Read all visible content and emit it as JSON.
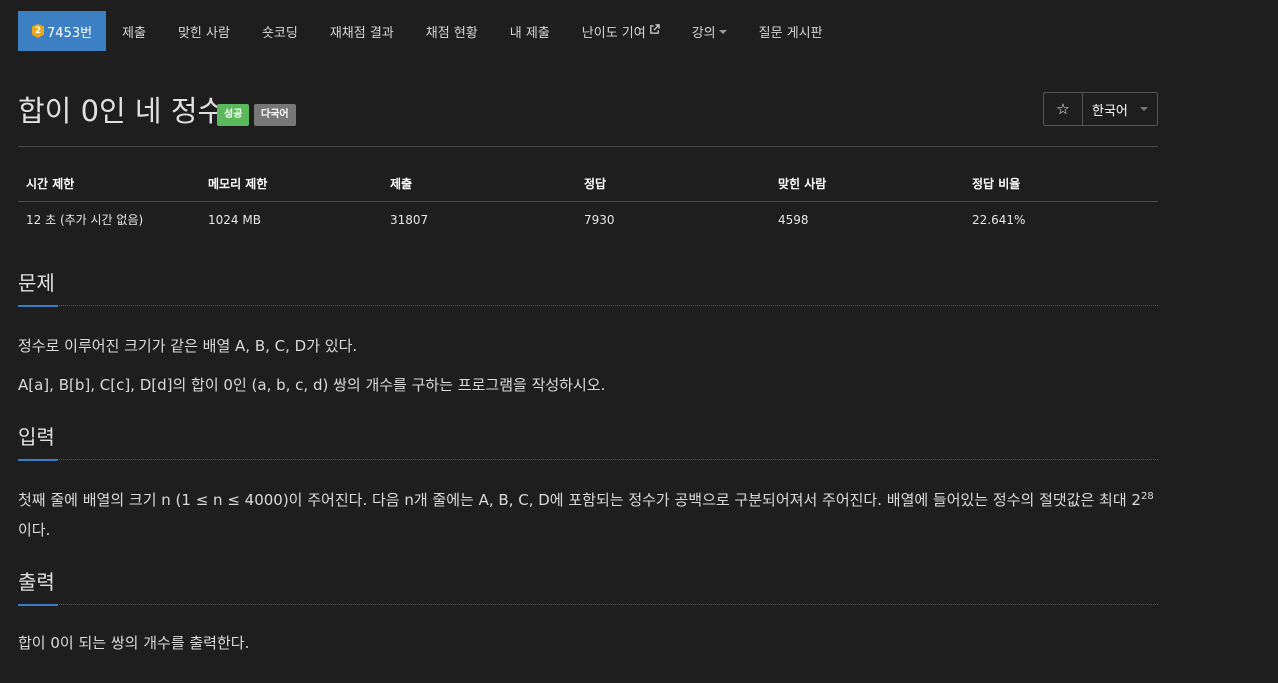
{
  "nav": {
    "problem_number": "7453번",
    "tier_badge": "2",
    "items": [
      "제출",
      "맞힌 사람",
      "숏코딩",
      "재채점 결과",
      "채점 현황",
      "내 제출",
      "난이도 기여",
      "강의",
      "질문 게시판"
    ]
  },
  "problem": {
    "title": "합이 0인 네 정수",
    "labels": [
      "성공",
      "다국어"
    ],
    "star": "☆",
    "language": "한국어"
  },
  "info": {
    "headers": [
      "시간 제한",
      "메모리 제한",
      "제출",
      "정답",
      "맞힌 사람",
      "정답 비율"
    ],
    "values": [
      "12 초 (추가 시간 없음)",
      "1024 MB",
      "31807",
      "7930",
      "4598",
      "22.641%"
    ]
  },
  "sections": {
    "description": {
      "title": "문제",
      "lines": [
        "정수로 이루어진 크기가 같은 배열 A, B, C, D가 있다.",
        "A[a], B[b], C[c], D[d]의 합이 0인 (a, b, c, d) 쌍의 개수를 구하는 프로그램을 작성하시오."
      ]
    },
    "input": {
      "title": "입력",
      "text": "첫째 줄에 배열의 크기 n (1 ≤ n ≤ 4000)이 주어진다. 다음 n개 줄에는 A, B, C, D에 포함되는 정수가 공백으로 구분되어져서 주어진다. 배열에 들어있는 정수의 절댓값은 최대",
      "power_base": "2",
      "power_exp": "28",
      "text_end": "이다."
    },
    "output": {
      "title": "출력",
      "text": "합이 0이 되는 쌍의 개수를 출력한다."
    }
  },
  "colors": {
    "background": "#1e1e1e",
    "nav_active": "#3c7fc3",
    "success_label": "#5cb85c",
    "multi_label": "#777777",
    "section_underline": "#3a7ac6"
  }
}
